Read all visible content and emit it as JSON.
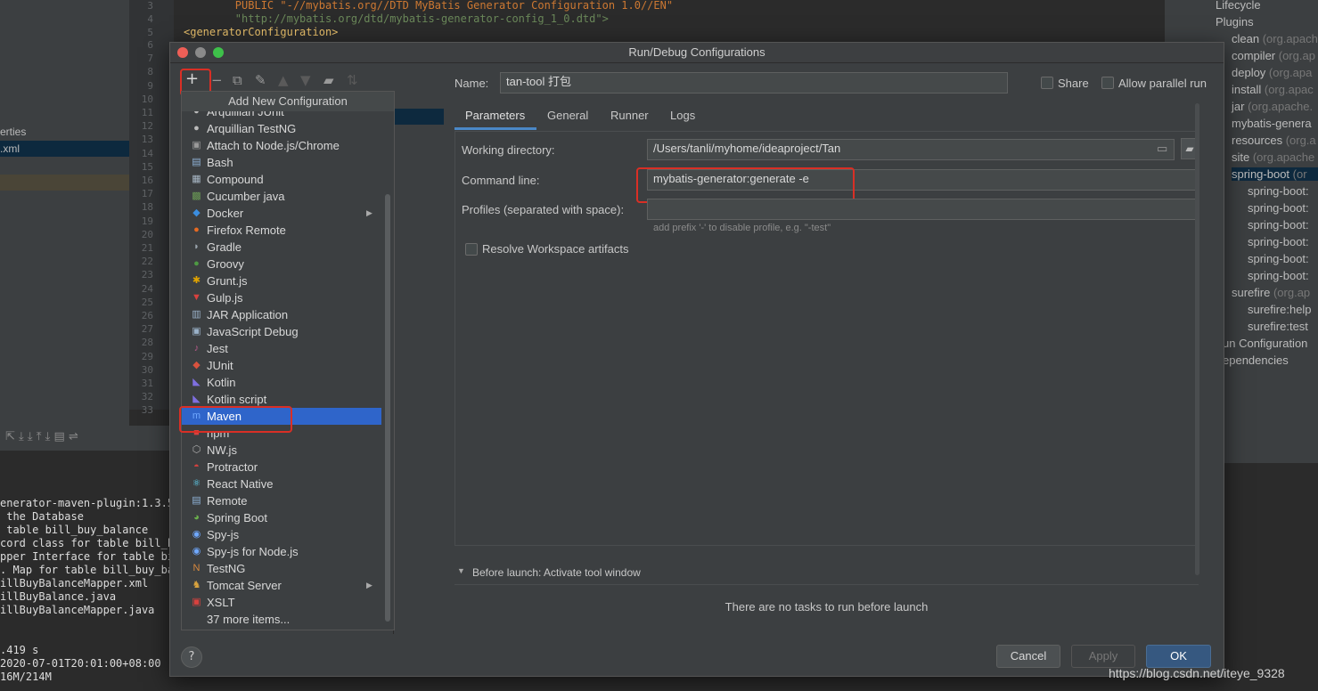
{
  "background": {
    "code_lines": [
      {
        "n": "3",
        "text": "        PUBLIC \"-//mybatis.org//DTD MyBatis Generator Configuration 1.0//EN\""
      },
      {
        "n": "4",
        "text": "        \"http://mybatis.org/dtd/mybatis-generator-config_1_0.dtd\">"
      },
      {
        "n": "5",
        "text": "<generatorConfiguration>"
      }
    ],
    "line_numbers": [
      "6",
      "7",
      "8",
      "9",
      "10",
      "11",
      "12",
      "13",
      "14",
      "15",
      "16",
      "17",
      "18",
      "19",
      "20",
      "21",
      "22",
      "23",
      "24",
      "25",
      "26",
      "27",
      "28",
      "29",
      "30",
      "31",
      "32",
      "33"
    ],
    "project_items": [
      "erties",
      ".xml"
    ],
    "console_lines": [
      "enerator-maven-plugin:1.3.5:",
      " the Database",
      " table bill_buy_balance",
      "cord class for table bill_bu",
      "pper Interface for table bil",
      ". Map for table bill_buy_bal",
      "illBuyBalanceMapper.xml",
      "illBuyBalance.java",
      "illBuyBalanceMapper.java",
      "",
      "",
      ".419 s",
      "2020-07-01T20:01:00+08:00",
      "16M/214M"
    ],
    "maven_panel": [
      {
        "name": "Lifecycle",
        "detail": ""
      },
      {
        "name": "Plugins",
        "detail": ""
      },
      {
        "name": "clean",
        "detail": "(org.apach"
      },
      {
        "name": "compiler",
        "detail": "(org.ap"
      },
      {
        "name": "deploy",
        "detail": "(org.apa"
      },
      {
        "name": "install",
        "detail": "(org.apac"
      },
      {
        "name": "jar",
        "detail": "(org.apache."
      },
      {
        "name": "mybatis-genera",
        "detail": ""
      },
      {
        "name": "resources",
        "detail": "(org.a"
      },
      {
        "name": "site",
        "detail": "(org.apache"
      },
      {
        "name": "spring-boot",
        "detail": "(or"
      },
      {
        "name": "spring-boot:",
        "detail": ""
      },
      {
        "name": "spring-boot:",
        "detail": ""
      },
      {
        "name": "spring-boot:",
        "detail": ""
      },
      {
        "name": "spring-boot:",
        "detail": ""
      },
      {
        "name": "spring-boot:",
        "detail": ""
      },
      {
        "name": "spring-boot:",
        "detail": ""
      },
      {
        "name": "surefire",
        "detail": "(org.ap"
      },
      {
        "name": "surefire:help",
        "detail": ""
      },
      {
        "name": "surefire:test",
        "detail": ""
      },
      {
        "name": "un Configuration",
        "detail": ""
      },
      {
        "name": "ependencies",
        "detail": ""
      }
    ]
  },
  "dialog": {
    "title": "Run/Debug Configurations",
    "popup_title": "Add New Configuration",
    "popup_items": [
      {
        "label": "Arquillian JUnit",
        "icon": "arquillian-icon",
        "color": "#bbbbbb",
        "glyph": "●"
      },
      {
        "label": "Arquillian TestNG",
        "icon": "arquillian-icon",
        "color": "#bbbbbb",
        "glyph": "●"
      },
      {
        "label": "Attach to Node.js/Chrome",
        "icon": "nodejs-icon",
        "color": "#9a9a9a",
        "glyph": "▣"
      },
      {
        "label": "Bash",
        "icon": "bash-icon",
        "color": "#8fb3d8",
        "glyph": "▤"
      },
      {
        "label": "Compound",
        "icon": "compound-icon",
        "color": "#a8b7c5",
        "glyph": "▦"
      },
      {
        "label": "Cucumber java",
        "icon": "cucumber-icon",
        "color": "#6a9955",
        "glyph": "▩"
      },
      {
        "label": "Docker",
        "icon": "docker-icon",
        "color": "#3b8ee0",
        "glyph": "◆",
        "submenu": "▶"
      },
      {
        "label": "Firefox Remote",
        "icon": "firefox-icon",
        "color": "#e66a22",
        "glyph": "●"
      },
      {
        "label": "Gradle",
        "icon": "gradle-icon",
        "color": "#9aa4ad",
        "glyph": "◗"
      },
      {
        "label": "Groovy",
        "icon": "groovy-icon",
        "color": "#4e9a43",
        "glyph": "●"
      },
      {
        "label": "Grunt.js",
        "icon": "grunt-icon",
        "color": "#e0a300",
        "glyph": "✱"
      },
      {
        "label": "Gulp.js",
        "icon": "gulp-icon",
        "color": "#d9413e",
        "glyph": "▼"
      },
      {
        "label": "JAR Application",
        "icon": "jar-icon",
        "color": "#9ab1c8",
        "glyph": "▥"
      },
      {
        "label": "JavaScript Debug",
        "icon": "js-debug-icon",
        "color": "#9ab1c8",
        "glyph": "▣"
      },
      {
        "label": "Jest",
        "icon": "jest-icon",
        "color": "#b85a8a",
        "glyph": "♪"
      },
      {
        "label": "JUnit",
        "icon": "junit-icon",
        "color": "#d9523e",
        "glyph": "◆"
      },
      {
        "label": "Kotlin",
        "icon": "kotlin-icon",
        "color": "#7f6fe0",
        "glyph": "◣"
      },
      {
        "label": "Kotlin script",
        "icon": "kotlin-script-icon",
        "color": "#7f6fe0",
        "glyph": "◣"
      },
      {
        "label": "Maven",
        "icon": "maven-icon",
        "color": "#6fa8ff",
        "glyph": "m"
      },
      {
        "label": "npm",
        "icon": "npm-icon",
        "color": "#d9413e",
        "glyph": "■"
      },
      {
        "label": "NW.js",
        "icon": "nwjs-icon",
        "color": "#b0b0b0",
        "glyph": "⬡"
      },
      {
        "label": "Protractor",
        "icon": "protractor-icon",
        "color": "#d9413e",
        "glyph": "◓"
      },
      {
        "label": "React Native",
        "icon": "react-icon",
        "color": "#61dafb",
        "glyph": "⚛"
      },
      {
        "label": "Remote",
        "icon": "remote-icon",
        "color": "#8fb3d8",
        "glyph": "▤"
      },
      {
        "label": "Spring Boot",
        "icon": "spring-boot-icon",
        "color": "#6ab04c",
        "glyph": "◕"
      },
      {
        "label": "Spy-js",
        "icon": "spyjs-icon",
        "color": "#6fa8ff",
        "glyph": "◉"
      },
      {
        "label": "Spy-js for Node.js",
        "icon": "spyjs-node-icon",
        "color": "#6fa8ff",
        "glyph": "◉"
      },
      {
        "label": "TestNG",
        "icon": "testng-icon",
        "color": "#d9893e",
        "glyph": "N"
      },
      {
        "label": "Tomcat Server",
        "icon": "tomcat-icon",
        "color": "#d9a33e",
        "glyph": "♞",
        "submenu": "▶"
      },
      {
        "label": "XSLT",
        "icon": "xslt-icon",
        "color": "#d9413e",
        "glyph": "▣"
      },
      {
        "label": "37 more items...",
        "icon": "",
        "color": "",
        "glyph": ""
      }
    ],
    "selected_item": "Maven",
    "name_label": "Name:",
    "name_value": "tan-tool 打包",
    "share_label": "Share",
    "parallel_label": "Allow parallel run",
    "tabs": [
      "Parameters",
      "General",
      "Runner",
      "Logs"
    ],
    "active_tab": "Parameters",
    "working_dir_label": "Working directory:",
    "working_dir_value": "/Users/tanli/myhome/ideaproject/Tan",
    "command_line_label": "Command line:",
    "command_line_value": "mybatis-generator:generate -e",
    "profiles_label": "Profiles (separated with space):",
    "profiles_value": "",
    "profiles_hint": "add prefix '-' to disable profile, e.g. \"-test\"",
    "resolve_label": "Resolve Workspace artifacts",
    "before_launch_label": "Before launch: Activate tool window",
    "no_tasks": "There are no tasks to run before launch",
    "cancel": "Cancel",
    "apply": "Apply",
    "ok": "OK",
    "help": "?"
  },
  "watermark": "https://blog.csdn.net/iteye_9328"
}
